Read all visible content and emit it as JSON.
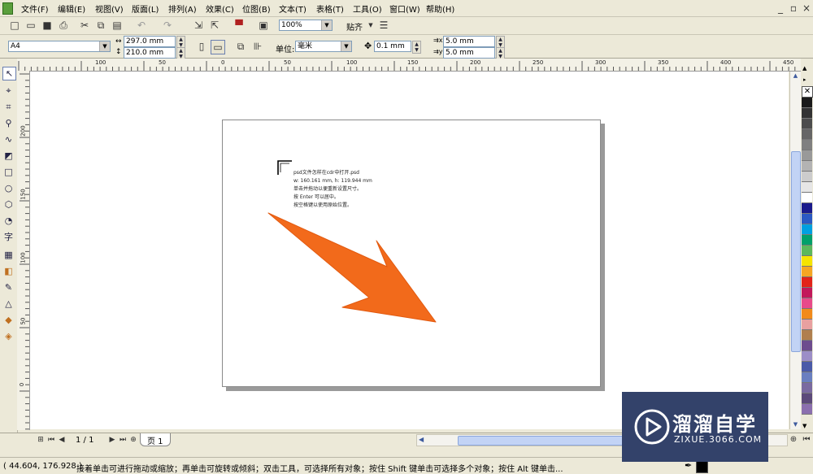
{
  "menubar": {
    "items": [
      "文件(F)",
      "编辑(E)",
      "视图(V)",
      "版面(L)",
      "排列(A)",
      "效果(C)",
      "位图(B)",
      "文本(T)",
      "表格(T)",
      "工具(O)",
      "窗口(W)",
      "帮助(H)"
    ]
  },
  "toolbar": {
    "zoom": "100%",
    "snap_label": "贴齐"
  },
  "propertybar": {
    "paper_size": "A4",
    "width": "297.0 mm",
    "height": "210.0 mm",
    "units_label": "单位:",
    "units_value": "毫米",
    "nudge": "0.1 mm",
    "dup_x": "5.0 mm",
    "dup_y": "5.0 mm"
  },
  "rulers": {
    "h_ticks": [
      "100",
      "50",
      "0",
      "50",
      "100",
      "150",
      "200",
      "250",
      "300",
      "350",
      "400",
      "450"
    ],
    "v_ticks": [
      "200",
      "150",
      "100",
      "50",
      "0"
    ]
  },
  "page_text": {
    "line1": "psd文件怎样在cdr中打开.psd",
    "line2": "w: 160.161 mm, h: 119.944 mm",
    "line3": "单击并拖动以便重新设置尺寸。",
    "line4": "按 Enter 可以居中。",
    "line5": "按空格键以使用原始位置。"
  },
  "pages": {
    "counter": "1 / 1",
    "tab_label": "页 1"
  },
  "status": {
    "coords": "( 44.604, 176.928 )",
    "hint": "接着单击可进行拖动或缩放；再单击可旋转或倾斜；双击工具，可选择所有对象；按住 Shift 键单击可选择多个对象；按住 Alt 键单击..."
  },
  "watermark": {
    "brand": "溜溜自学",
    "url": "ZIXUE.3066.COM"
  },
  "colors": {
    "arrow": "#f26a1b",
    "watermark_bg": "#33426a",
    "palette": [
      "#1a1a1a",
      "#333333",
      "#4d4d4d",
      "#666666",
      "#808080",
      "#999999",
      "#b3b3b3",
      "#cccccc",
      "#e6e6e6",
      "#ffffff",
      "#1a1a8c",
      "#2b59c3",
      "#00a0e0",
      "#00a06a",
      "#5cb85c",
      "#f6e400",
      "#f5a623",
      "#e2231a",
      "#c2185b",
      "#e84a8a",
      "#f28a1b",
      "#e8a0a0",
      "#b07f4e",
      "#6d4c8e",
      "#9c8ec7",
      "#4a5aa8",
      "#6a7fc0",
      "#7a6aa0",
      "#5c4a7a",
      "#8b6fae"
    ]
  }
}
